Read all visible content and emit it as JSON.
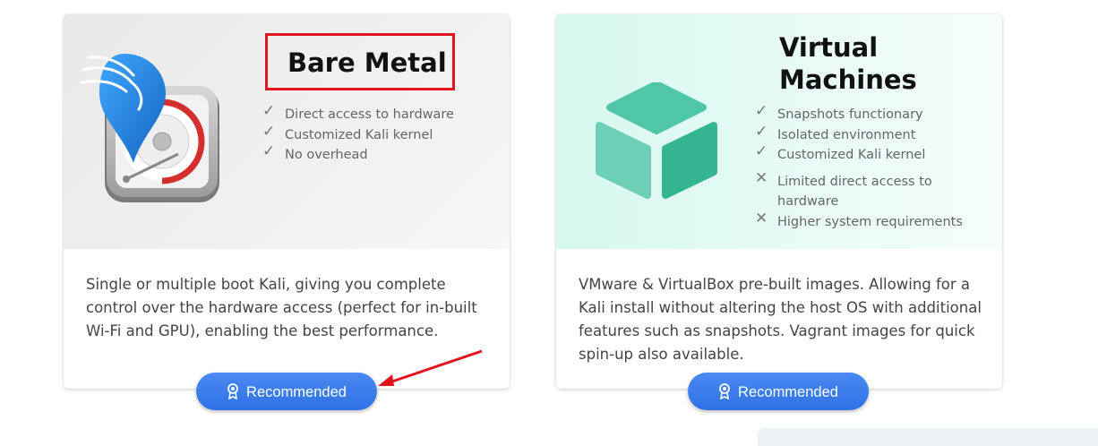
{
  "cards": {
    "bare_metal": {
      "title": "Bare Metal",
      "features": [
        {
          "kind": "check",
          "text": "Direct access to hardware"
        },
        {
          "kind": "check",
          "text": "Customized Kali kernel"
        },
        {
          "kind": "check",
          "text": "No overhead"
        }
      ],
      "description": "Single or multiple boot Kali, giving you complete control over the hardware access (perfect for in-built Wi-Fi and GPU), enabling the best performance.",
      "button_label": "Recommended"
    },
    "virtual_machines": {
      "title": "Virtual Machines",
      "features": [
        {
          "kind": "check",
          "text": "Snapshots functionary"
        },
        {
          "kind": "check",
          "text": "Isolated environment"
        },
        {
          "kind": "check",
          "text": "Customized Kali kernel"
        },
        {
          "kind": "cross",
          "text": "Limited direct access to hardware"
        },
        {
          "kind": "cross",
          "text": "Higher system requirements"
        }
      ],
      "description": "VMware & VirtualBox pre-built images. Allowing for a Kali install without altering the host OS with additional features such as snapshots. Vagrant images for quick spin-up also available.",
      "button_label": "Recommended"
    }
  },
  "icons": {
    "check": "✓",
    "cross": "✕",
    "button_icon": "award-ribbon-icon"
  },
  "colors": {
    "button_blue": "#3579ec",
    "highlight_red": "#e0141e",
    "vm_accent": "#3fbf9e",
    "kali_blue": "#1e88e5"
  }
}
